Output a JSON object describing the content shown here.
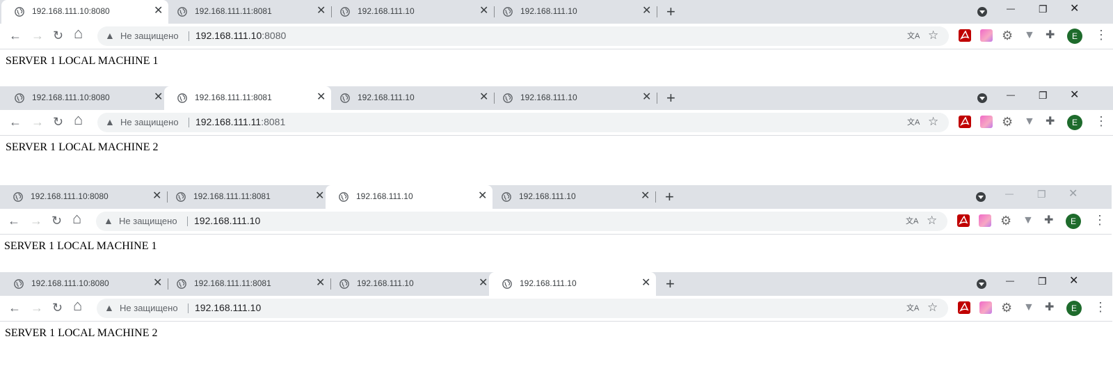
{
  "windows": [
    {
      "tabs": [
        {
          "title": "192.168.111.10:8080",
          "close_label": "✕"
        },
        {
          "title": "192.168.111.11:8081",
          "close_label": "✕"
        },
        {
          "title": "192.168.111.10",
          "close_label": "✕"
        },
        {
          "title": "192.168.111.10",
          "close_label": "✕"
        }
      ],
      "active_tab": 0,
      "new_tab_label": "+",
      "security_label": "Не защищено",
      "url_host": "192.168.111.10",
      "url_port": ":8080",
      "page_text": "SERVER 1 LOCAL MACHINE 1",
      "avatar_letter": "E",
      "focused": true
    },
    {
      "tabs": [
        {
          "title": "192.168.111.10:8080",
          "close_label": "✕"
        },
        {
          "title": "192.168.111.11:8081",
          "close_label": "✕"
        },
        {
          "title": "192.168.111.10",
          "close_label": "✕"
        },
        {
          "title": "192.168.111.10",
          "close_label": "✕"
        }
      ],
      "active_tab": 1,
      "new_tab_label": "+",
      "security_label": "Не защищено",
      "url_host": "192.168.111.11",
      "url_port": ":8081",
      "page_text": "SERVER 1 LOCAL MACHINE 2",
      "avatar_letter": "E",
      "focused": true
    },
    {
      "tabs": [
        {
          "title": "192.168.111.10:8080",
          "close_label": "✕"
        },
        {
          "title": "192.168.111.11:8081",
          "close_label": "✕"
        },
        {
          "title": "192.168.111.10",
          "close_label": "✕"
        },
        {
          "title": "192.168.111.10",
          "close_label": "✕"
        }
      ],
      "active_tab": 2,
      "new_tab_label": "+",
      "security_label": "Не защищено",
      "url_host": "192.168.111.10",
      "url_port": "",
      "page_text": "SERVER 1 LOCAL MACHINE 1",
      "avatar_letter": "E",
      "focused": false
    },
    {
      "tabs": [
        {
          "title": "192.168.111.10:8080",
          "close_label": "✕"
        },
        {
          "title": "192.168.111.11:8081",
          "close_label": "✕"
        },
        {
          "title": "192.168.111.10",
          "close_label": "✕"
        },
        {
          "title": "192.168.111.10",
          "close_label": "✕"
        }
      ],
      "active_tab": 3,
      "new_tab_label": "+",
      "security_label": "Не защищено",
      "url_host": "192.168.111.10",
      "url_port": "",
      "page_text": "SERVER 1 LOCAL MACHINE 2",
      "avatar_letter": "E",
      "focused": true
    }
  ],
  "icons": {
    "back": "arrow-left-icon",
    "forward": "arrow-right-icon",
    "reload": "reload-icon",
    "home": "home-icon",
    "warning": "warning-triangle-icon",
    "translate": "translate-icon",
    "bookmark": "star-icon",
    "pdf_extension": "pdf-icon",
    "gradient_extension": "gradient-square-icon",
    "gear_extension": "gear-icon",
    "v_extension": "v-shield-icon",
    "extensions": "puzzle-icon",
    "menu": "kebab-menu-icon",
    "tab_search": "tab-search-dropdown-icon",
    "tab_favicon": "globe-icon"
  },
  "colors": {
    "tabstrip_bg": "#dee1e6",
    "active_tab_bg": "#ffffff",
    "omnibox_bg": "#f1f3f4",
    "avatar_bg": "#1e6b2c",
    "pdf_red": "#c00000"
  }
}
